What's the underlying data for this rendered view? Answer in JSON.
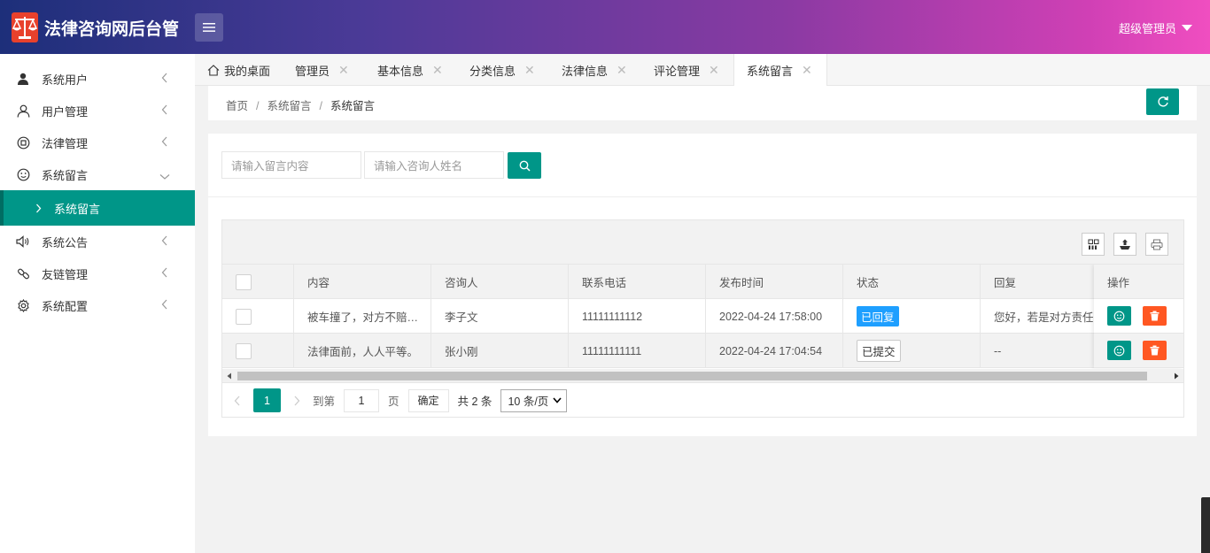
{
  "header": {
    "title": "法律咨询网后台管",
    "user": "超级管理员"
  },
  "sidebar": {
    "items": [
      {
        "label": "系统用户",
        "icon": "user-solid-icon"
      },
      {
        "label": "用户管理",
        "icon": "user-outline-icon"
      },
      {
        "label": "法律管理",
        "icon": "circle-square-icon"
      },
      {
        "label": "系统留言",
        "icon": "smile-icon"
      },
      {
        "label": "系统公告",
        "icon": "speaker-icon"
      },
      {
        "label": "友链管理",
        "icon": "link-icon"
      },
      {
        "label": "系统配置",
        "icon": "gear-icon"
      }
    ],
    "sub_active": "系统留言"
  },
  "tabs": [
    {
      "label": "我的桌面"
    },
    {
      "label": "管理员"
    },
    {
      "label": "基本信息"
    },
    {
      "label": "分类信息"
    },
    {
      "label": "法律信息"
    },
    {
      "label": "评论管理"
    },
    {
      "label": "系统留言"
    }
  ],
  "breadcrumb": [
    "首页",
    "系统留言",
    "系统留言"
  ],
  "search": {
    "content_placeholder": "请输入留言内容",
    "name_placeholder": "请输入咨询人姓名"
  },
  "table": {
    "columns": [
      "内容",
      "咨询人",
      "联系电话",
      "发布时间",
      "状态",
      "回复",
      "操作"
    ],
    "rows": [
      {
        "content": "被车撞了，对方不赔…",
        "person": "李子文",
        "phone": "11111111112",
        "time": "2022-04-24 17:58:00",
        "status": "已回复",
        "reply": "您好，若是对方责任…"
      },
      {
        "content": "法律面前，人人平等。",
        "person": "张小刚",
        "phone": "11111111111",
        "time": "2022-04-24 17:04:54",
        "status": "已提交",
        "reply": "--"
      }
    ]
  },
  "pager": {
    "current": "1",
    "goto_label": "到第",
    "goto_value": "1",
    "page_label": "页",
    "confirm": "确定",
    "total": "共 2 条",
    "per_page": "10 条/页"
  },
  "colors": {
    "teal": "#009688",
    "blue": "#1e9fff",
    "orange": "#ff5722"
  }
}
